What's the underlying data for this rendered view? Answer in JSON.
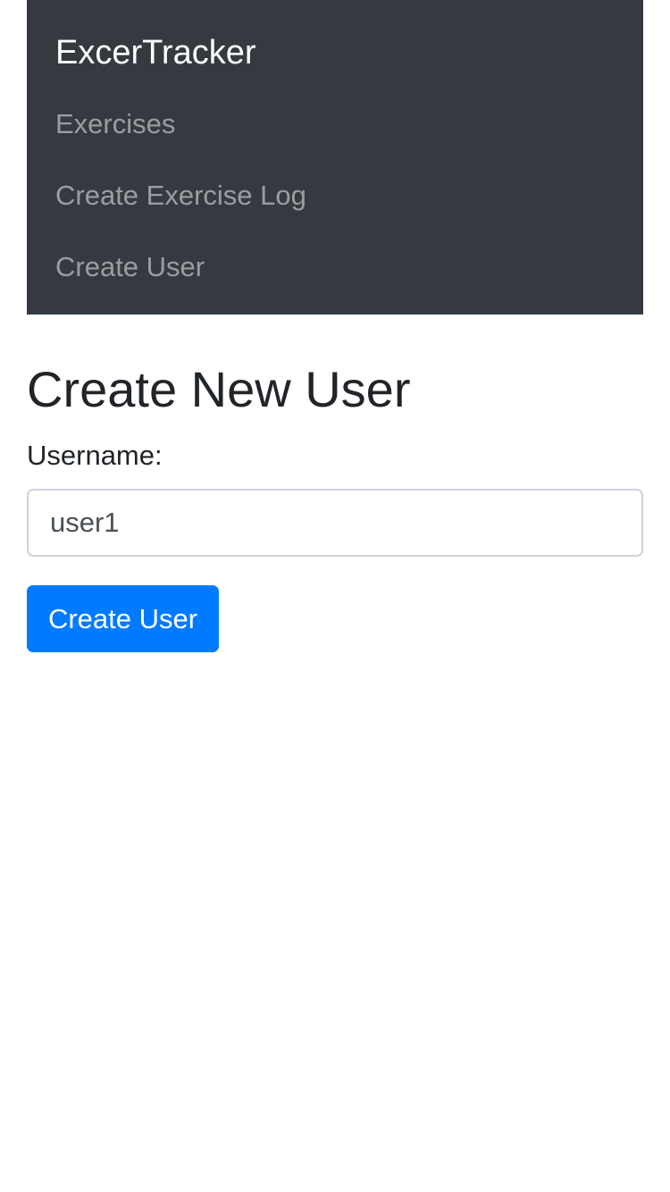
{
  "navbar": {
    "brand": "ExcerTracker",
    "items": [
      {
        "label": "Exercises"
      },
      {
        "label": "Create Exercise Log"
      },
      {
        "label": "Create User"
      }
    ]
  },
  "form": {
    "title": "Create New User",
    "username_label": "Username:",
    "username_value": "user1",
    "submit_label": "Create User"
  },
  "colors": {
    "navbar_bg": "#343a40",
    "primary": "#007bff"
  }
}
